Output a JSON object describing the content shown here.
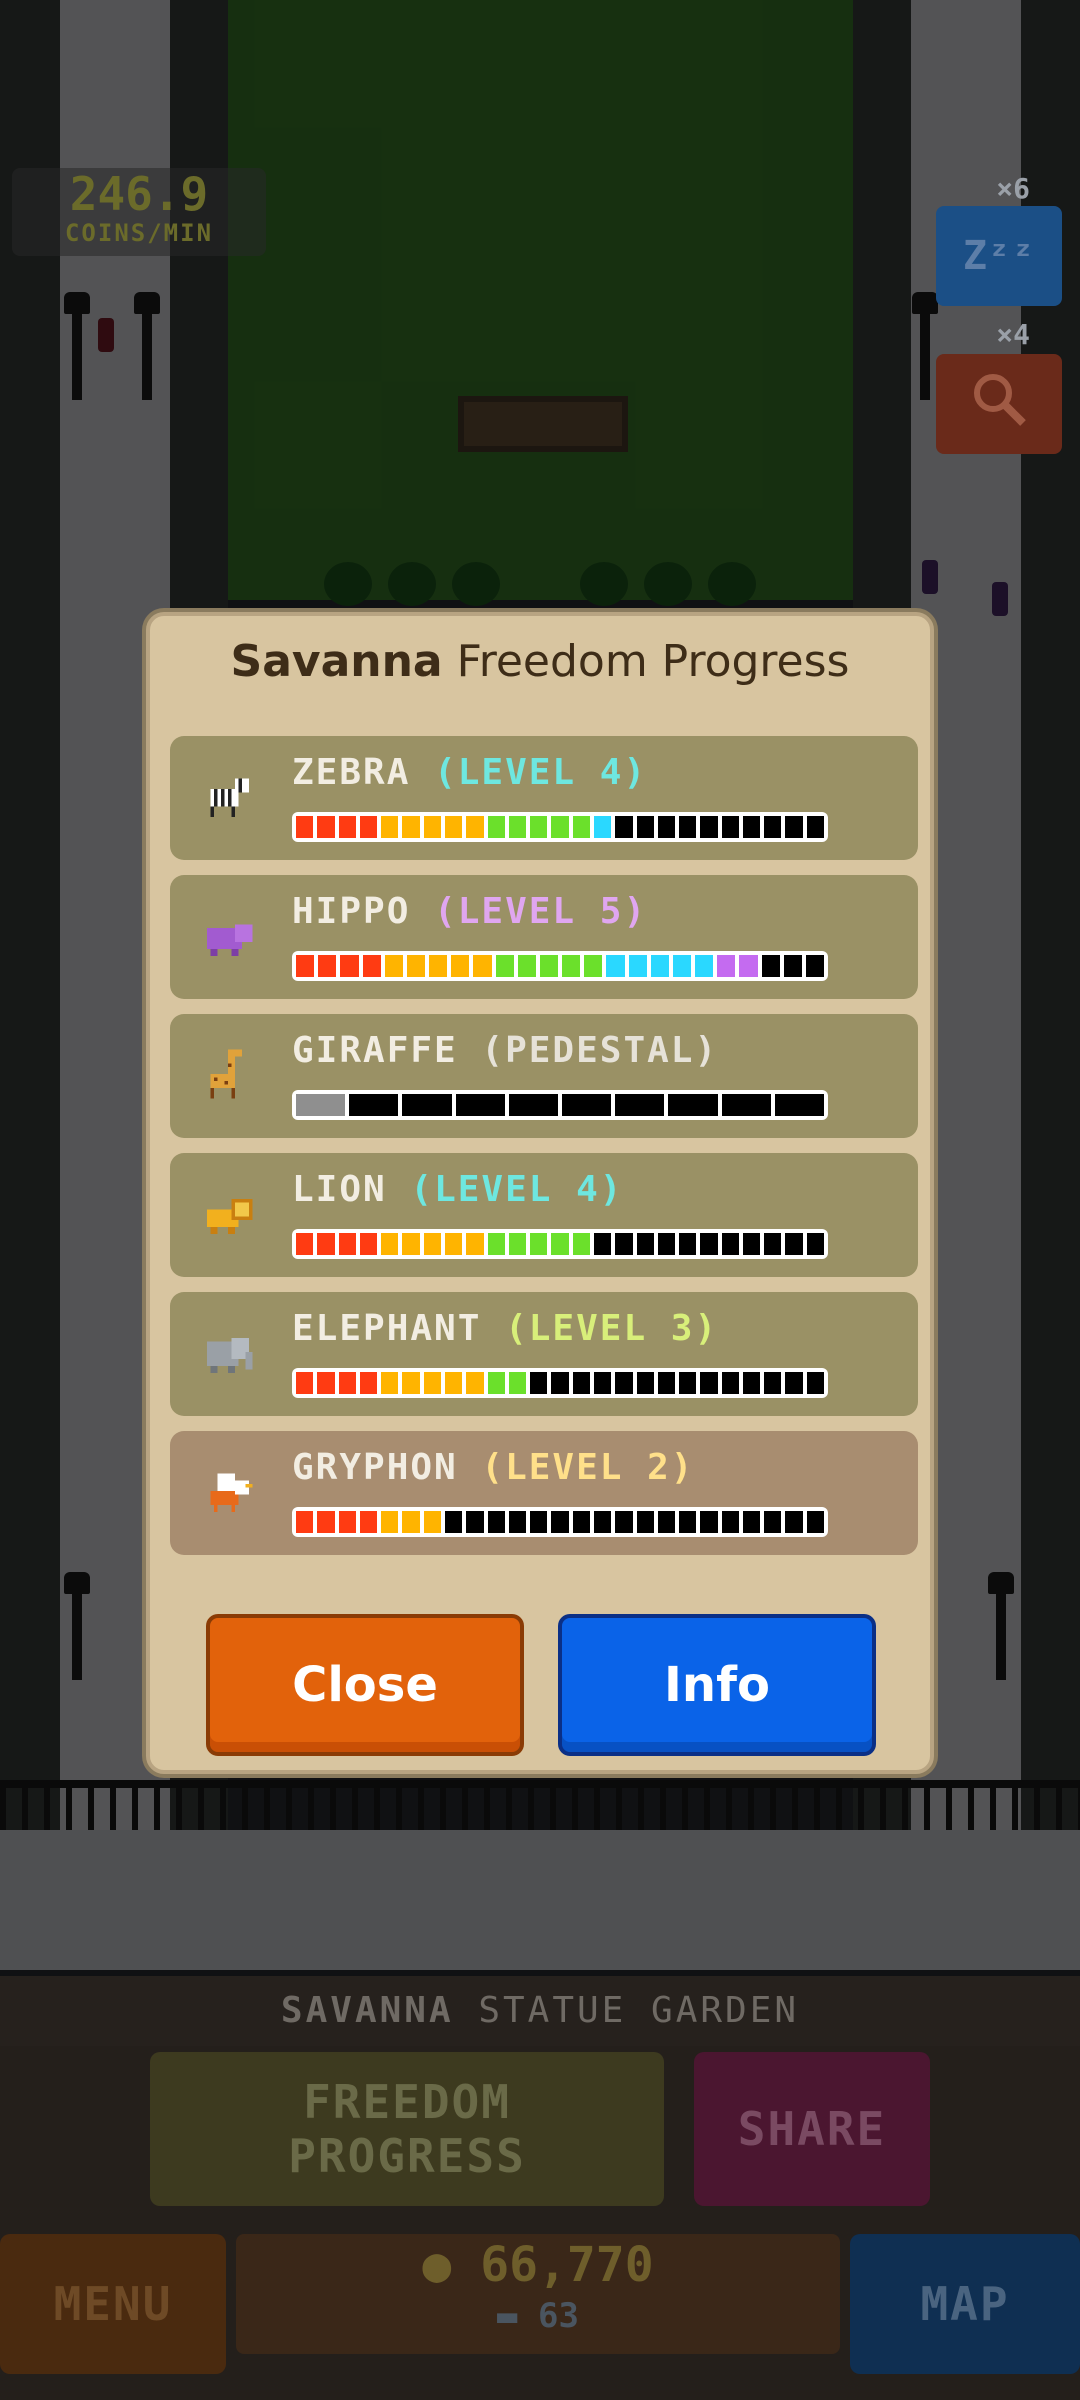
{
  "hud": {
    "coins_per_min_value": "246.9",
    "coins_per_min_label": "COINS/MIN",
    "boost_sleep_count": "×6",
    "boost_sleep_label": "Zᶻᶻ",
    "boost_search_count": "×4"
  },
  "modal": {
    "title_bold": "Savanna",
    "title_rest": " Freedom Progress",
    "animals": [
      {
        "name": "ZEBRA",
        "level": "(LEVEL 4)",
        "level_color": "#6ee7e0",
        "icon": "zebra-icon",
        "segments": [
          "#ff3b12",
          "#ff3b12",
          "#ff3b12",
          "#ff3b12",
          "#ffb400",
          "#ffb400",
          "#ffb400",
          "#ffb400",
          "#ffb400",
          "#6be02b",
          "#6be02b",
          "#6be02b",
          "#6be02b",
          "#6be02b",
          "#2ad8ff",
          "#000000",
          "#000000",
          "#000000",
          "#000000",
          "#000000",
          "#000000",
          "#000000",
          "#000000",
          "#000000",
          "#000000"
        ]
      },
      {
        "name": "HIPPO",
        "level": "(LEVEL 5)",
        "level_color": "#e0a6f0",
        "icon": "hippo-icon",
        "segments": [
          "#ff3b12",
          "#ff3b12",
          "#ff3b12",
          "#ff3b12",
          "#ffb400",
          "#ffb400",
          "#ffb400",
          "#ffb400",
          "#ffb400",
          "#6be02b",
          "#6be02b",
          "#6be02b",
          "#6be02b",
          "#6be02b",
          "#2ad8ff",
          "#2ad8ff",
          "#2ad8ff",
          "#2ad8ff",
          "#2ad8ff",
          "#c46bf0",
          "#c46bf0",
          "#000000",
          "#000000",
          "#000000"
        ]
      },
      {
        "name": "GIRAFFE",
        "level": "(PEDESTAL)",
        "level_color": "#e6e2d8",
        "icon": "giraffe-icon",
        "segments": [
          "#8f8f8f",
          "#000000",
          "#000000",
          "#000000",
          "#000000",
          "#000000",
          "#000000",
          "#000000",
          "#000000",
          "#000000"
        ]
      },
      {
        "name": "LION",
        "level": "(LEVEL 4)",
        "level_color": "#6ee7e0",
        "icon": "lion-icon",
        "segments": [
          "#ff3b12",
          "#ff3b12",
          "#ff3b12",
          "#ff3b12",
          "#ffb400",
          "#ffb400",
          "#ffb400",
          "#ffb400",
          "#ffb400",
          "#6be02b",
          "#6be02b",
          "#6be02b",
          "#6be02b",
          "#6be02b",
          "#000000",
          "#000000",
          "#000000",
          "#000000",
          "#000000",
          "#000000",
          "#000000",
          "#000000",
          "#000000",
          "#000000",
          "#000000"
        ]
      },
      {
        "name": "ELEPHANT",
        "level": "(LEVEL 3)",
        "level_color": "#d8ef7a",
        "icon": "elephant-icon",
        "segments": [
          "#ff3b12",
          "#ff3b12",
          "#ff3b12",
          "#ff3b12",
          "#ffb400",
          "#ffb400",
          "#ffb400",
          "#ffb400",
          "#ffb400",
          "#6be02b",
          "#6be02b",
          "#000000",
          "#000000",
          "#000000",
          "#000000",
          "#000000",
          "#000000",
          "#000000",
          "#000000",
          "#000000",
          "#000000",
          "#000000",
          "#000000",
          "#000000",
          "#000000"
        ]
      },
      {
        "name": "GRYPHON",
        "level": "(LEVEL 2)",
        "level_color": "#ffe08a",
        "icon": "gryphon-icon",
        "segments": [
          "#ff3b12",
          "#ff3b12",
          "#ff3b12",
          "#ff3b12",
          "#ffb400",
          "#ffb400",
          "#ffb400",
          "#000000",
          "#000000",
          "#000000",
          "#000000",
          "#000000",
          "#000000",
          "#000000",
          "#000000",
          "#000000",
          "#000000",
          "#000000",
          "#000000",
          "#000000",
          "#000000",
          "#000000",
          "#000000",
          "#000000",
          "#000000"
        ]
      }
    ],
    "close_label": "Close",
    "info_label": "Info"
  },
  "bottom": {
    "garden_title_bold": "SAVANNA",
    "garden_title_rest": " STATUE GARDEN",
    "freedom_progress_label": "FREEDOM PROGRESS",
    "share_label": "SHARE",
    "menu_label": "MENU",
    "coins": "66,770",
    "tickets": "63",
    "map_label": "MAP"
  }
}
